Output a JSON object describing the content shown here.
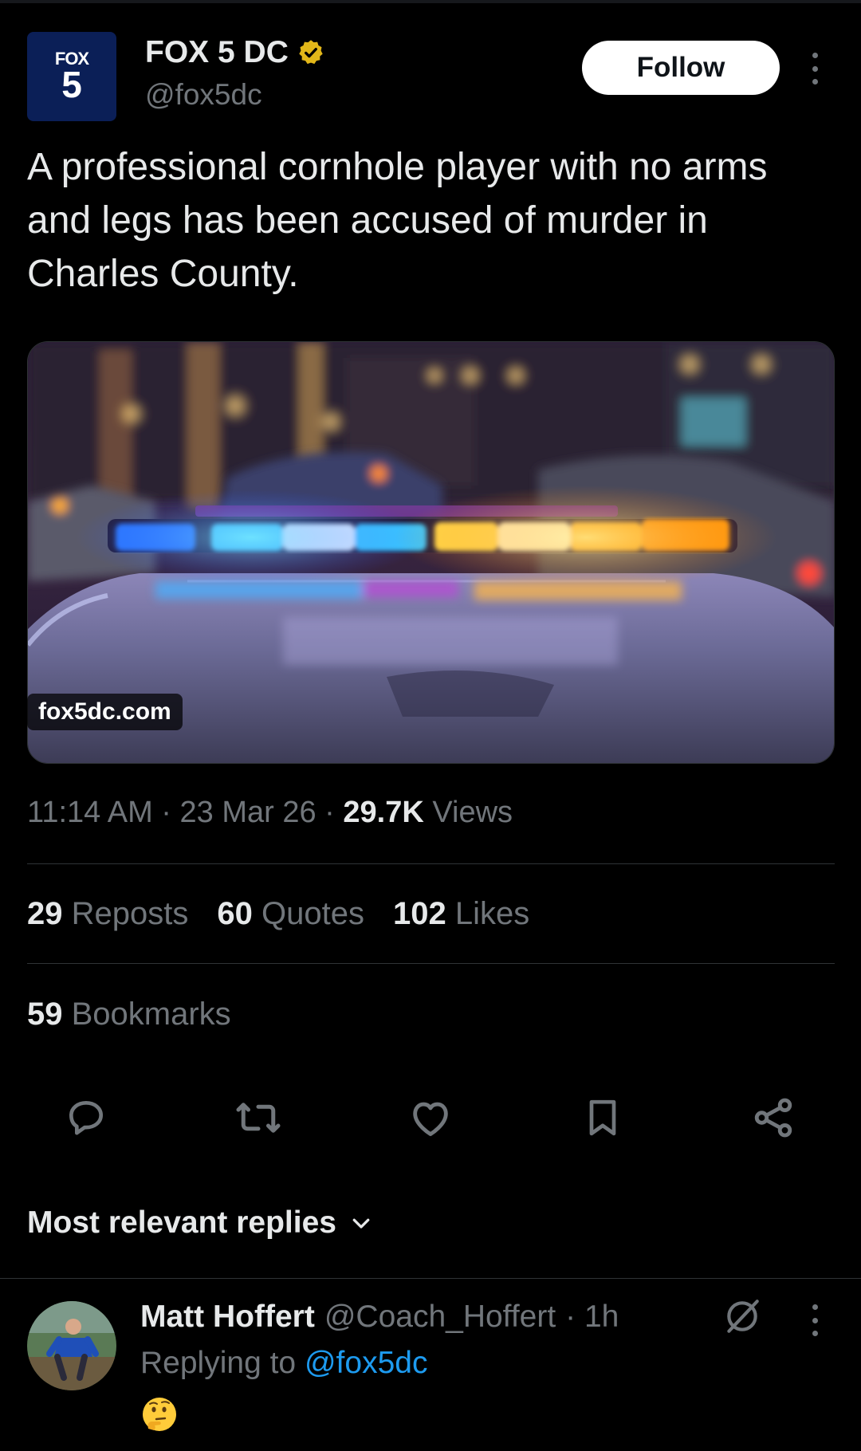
{
  "post": {
    "author_name": "FOX 5 DC",
    "author_handle": "@fox5dc",
    "avatar_text_top": "FOX",
    "avatar_text_bottom": "5",
    "follow_label": "Follow",
    "text": "A professional cornhole player with no arms and legs has been accused of murder in Charles County.",
    "media_domain": "fox5dc.com",
    "time": "11:14 AM",
    "date": "23 Mar 26",
    "views_count": "29.7K",
    "views_label": "Views",
    "separator": "·"
  },
  "stats": {
    "reposts_count": "29",
    "reposts_label": "Reposts",
    "quotes_count": "60",
    "quotes_label": "Quotes",
    "likes_count": "102",
    "likes_label": "Likes",
    "bookmarks_count": "59",
    "bookmarks_label": "Bookmarks"
  },
  "actions": [
    "reply-icon",
    "repost-icon",
    "like-icon",
    "bookmark-icon",
    "share-icon"
  ],
  "replies": {
    "sort_label": "Most relevant replies",
    "items": [
      {
        "name": "Matt Hoffert",
        "handle": "@Coach_Hoffert",
        "time": "· 1h",
        "replying_prefix": "Replying to",
        "replying_to": "@fox5dc",
        "emoji_icon": "thinking-face-icon"
      }
    ]
  },
  "colors": {
    "background": "#000000",
    "text": "#e7e9ea",
    "muted": "#71767b",
    "link": "#1d9bf0",
    "divider": "#2f3336",
    "verified_gold": "#e2b719"
  }
}
